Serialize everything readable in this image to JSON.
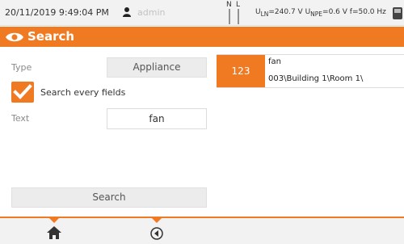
{
  "status": {
    "datetime": "20/11/2019 9:49:04 PM",
    "user": "admin",
    "phase_n": "N",
    "phase_l": "L",
    "voltage_html": "U<sub>LN</sub>=240.7 V U<sub>NPE</sub>=0.6 V f=50.0 Hz"
  },
  "title": "Search",
  "form": {
    "type_label": "Type",
    "type_value": "Appliance",
    "search_every_label": "Search every fields",
    "search_every_checked": true,
    "text_label": "Text",
    "text_value": "fan",
    "search_button": "Search"
  },
  "results": [
    {
      "number": "123",
      "name": "fan",
      "path": "003\\Building 1\\Room 1\\"
    }
  ],
  "colors": {
    "accent": "#f07a22"
  },
  "icons": {
    "user": "user-icon",
    "home": "home-icon",
    "back": "back-icon",
    "device": "meter-icon"
  }
}
